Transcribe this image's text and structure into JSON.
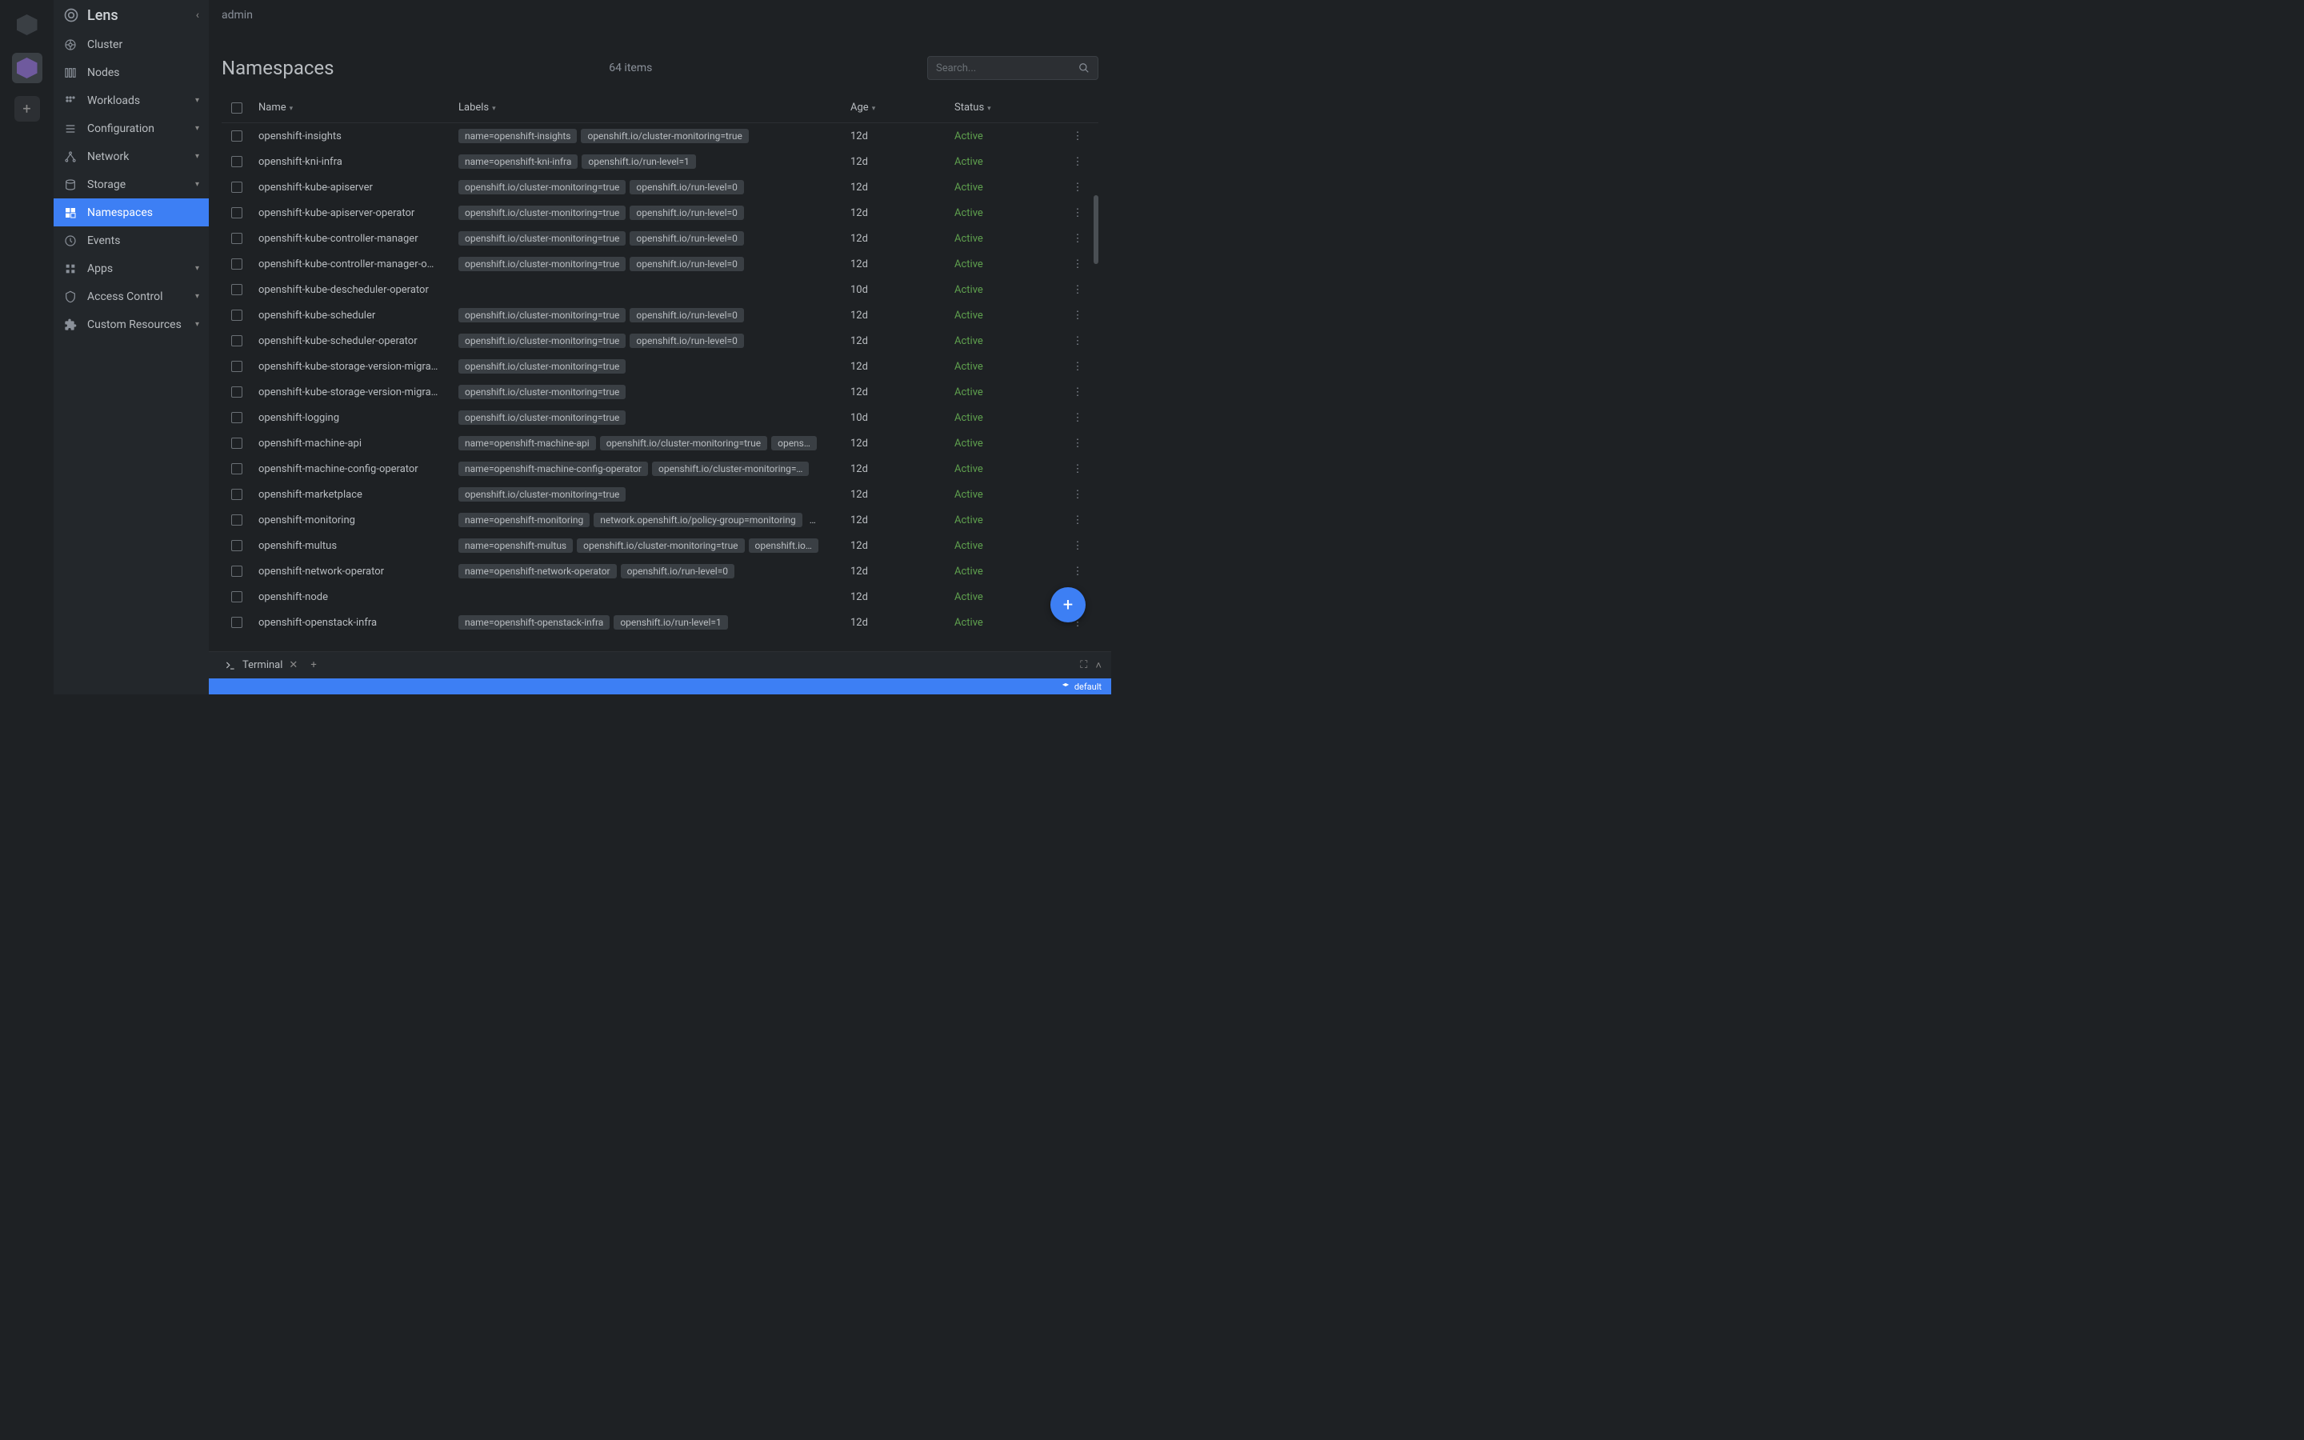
{
  "app": {
    "title": "Lens",
    "context": "admin"
  },
  "rail": {
    "add": "+"
  },
  "nav": [
    {
      "label": "Cluster",
      "icon": "helm",
      "expandable": false
    },
    {
      "label": "Nodes",
      "icon": "nodes",
      "expandable": false
    },
    {
      "label": "Workloads",
      "icon": "workloads",
      "expandable": true
    },
    {
      "label": "Configuration",
      "icon": "config",
      "expandable": true
    },
    {
      "label": "Network",
      "icon": "network",
      "expandable": true
    },
    {
      "label": "Storage",
      "icon": "storage",
      "expandable": true
    },
    {
      "label": "Namespaces",
      "icon": "namespaces",
      "expandable": false,
      "selected": true
    },
    {
      "label": "Events",
      "icon": "events",
      "expandable": false
    },
    {
      "label": "Apps",
      "icon": "apps",
      "expandable": true
    },
    {
      "label": "Access Control",
      "icon": "access",
      "expandable": true
    },
    {
      "label": "Custom Resources",
      "icon": "custom",
      "expandable": true
    }
  ],
  "page": {
    "title": "Namespaces",
    "count": "64 items",
    "search_placeholder": "Search..."
  },
  "columns": {
    "name": "Name",
    "labels": "Labels",
    "age": "Age",
    "status": "Status"
  },
  "rows": [
    {
      "name": "openshift-insights",
      "labels": [
        "name=openshift-insights",
        "openshift.io/cluster-monitoring=true"
      ],
      "age": "12d",
      "status": "Active"
    },
    {
      "name": "openshift-kni-infra",
      "labels": [
        "name=openshift-kni-infra",
        "openshift.io/run-level=1"
      ],
      "age": "12d",
      "status": "Active"
    },
    {
      "name": "openshift-kube-apiserver",
      "labels": [
        "openshift.io/cluster-monitoring=true",
        "openshift.io/run-level=0"
      ],
      "age": "12d",
      "status": "Active"
    },
    {
      "name": "openshift-kube-apiserver-operator",
      "labels": [
        "openshift.io/cluster-monitoring=true",
        "openshift.io/run-level=0"
      ],
      "age": "12d",
      "status": "Active"
    },
    {
      "name": "openshift-kube-controller-manager",
      "labels": [
        "openshift.io/cluster-monitoring=true",
        "openshift.io/run-level=0"
      ],
      "age": "12d",
      "status": "Active"
    },
    {
      "name": "openshift-kube-controller-manager-o…",
      "labels": [
        "openshift.io/cluster-monitoring=true",
        "openshift.io/run-level=0"
      ],
      "age": "12d",
      "status": "Active"
    },
    {
      "name": "openshift-kube-descheduler-operator",
      "labels": [],
      "age": "10d",
      "status": "Active"
    },
    {
      "name": "openshift-kube-scheduler",
      "labels": [
        "openshift.io/cluster-monitoring=true",
        "openshift.io/run-level=0"
      ],
      "age": "12d",
      "status": "Active"
    },
    {
      "name": "openshift-kube-scheduler-operator",
      "labels": [
        "openshift.io/cluster-monitoring=true",
        "openshift.io/run-level=0"
      ],
      "age": "12d",
      "status": "Active"
    },
    {
      "name": "openshift-kube-storage-version-migra…",
      "labels": [
        "openshift.io/cluster-monitoring=true"
      ],
      "age": "12d",
      "status": "Active"
    },
    {
      "name": "openshift-kube-storage-version-migra…",
      "labels": [
        "openshift.io/cluster-monitoring=true"
      ],
      "age": "12d",
      "status": "Active"
    },
    {
      "name": "openshift-logging",
      "labels": [
        "openshift.io/cluster-monitoring=true"
      ],
      "age": "10d",
      "status": "Active"
    },
    {
      "name": "openshift-machine-api",
      "labels": [
        "name=openshift-machine-api",
        "openshift.io/cluster-monitoring=true",
        "opens…"
      ],
      "age": "12d",
      "status": "Active"
    },
    {
      "name": "openshift-machine-config-operator",
      "labels": [
        "name=openshift-machine-config-operator",
        "openshift.io/cluster-monitoring=…"
      ],
      "age": "12d",
      "status": "Active"
    },
    {
      "name": "openshift-marketplace",
      "labels": [
        "openshift.io/cluster-monitoring=true"
      ],
      "age": "12d",
      "status": "Active"
    },
    {
      "name": "openshift-monitoring",
      "labels": [
        "name=openshift-monitoring",
        "network.openshift.io/policy-group=monitoring"
      ],
      "more": "…",
      "age": "12d",
      "status": "Active"
    },
    {
      "name": "openshift-multus",
      "labels": [
        "name=openshift-multus",
        "openshift.io/cluster-monitoring=true",
        "openshift.io…"
      ],
      "age": "12d",
      "status": "Active"
    },
    {
      "name": "openshift-network-operator",
      "labels": [
        "name=openshift-network-operator",
        "openshift.io/run-level=0"
      ],
      "age": "12d",
      "status": "Active"
    },
    {
      "name": "openshift-node",
      "labels": [],
      "age": "12d",
      "status": "Active"
    },
    {
      "name": "openshift-openstack-infra",
      "labels": [
        "name=openshift-openstack-infra",
        "openshift.io/run-level=1"
      ],
      "age": "12d",
      "status": "Active"
    }
  ],
  "terminal": {
    "tab": "Terminal"
  },
  "statusbar": {
    "ns": "default"
  }
}
